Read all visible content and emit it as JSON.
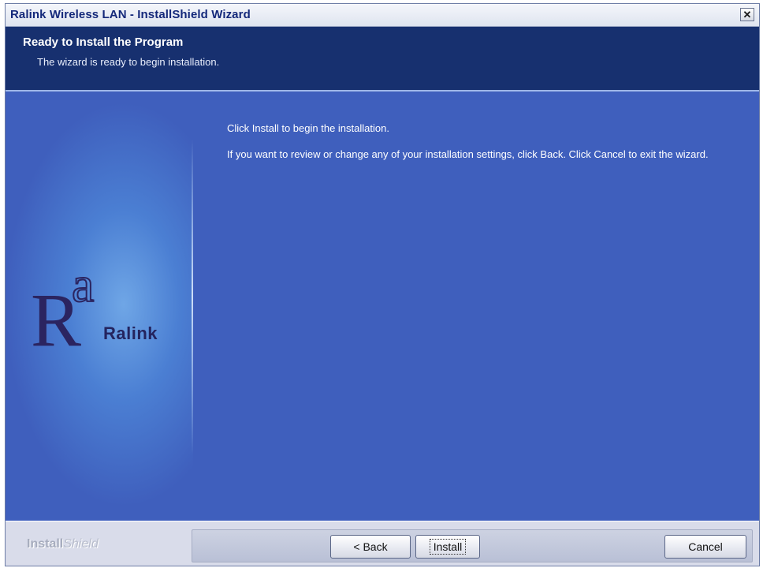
{
  "window": {
    "title": "Ralink Wireless LAN - InstallShield Wizard",
    "close_symbol": "✕"
  },
  "header": {
    "title": "Ready to Install the Program",
    "subtitle": "The wizard is ready to begin installation."
  },
  "logo": {
    "word": "Ralink",
    "icon": "ralink-ra-logo"
  },
  "body": {
    "paragraphs": [
      "Click Install to begin the installation.",
      "If you want to review or change any of your installation settings, click Back. Click Cancel to exit the wizard."
    ]
  },
  "footer": {
    "brand_install": "Install",
    "brand_shield": "Shield",
    "back_label": "< Back",
    "install_label": "Install",
    "cancel_label": "Cancel"
  }
}
